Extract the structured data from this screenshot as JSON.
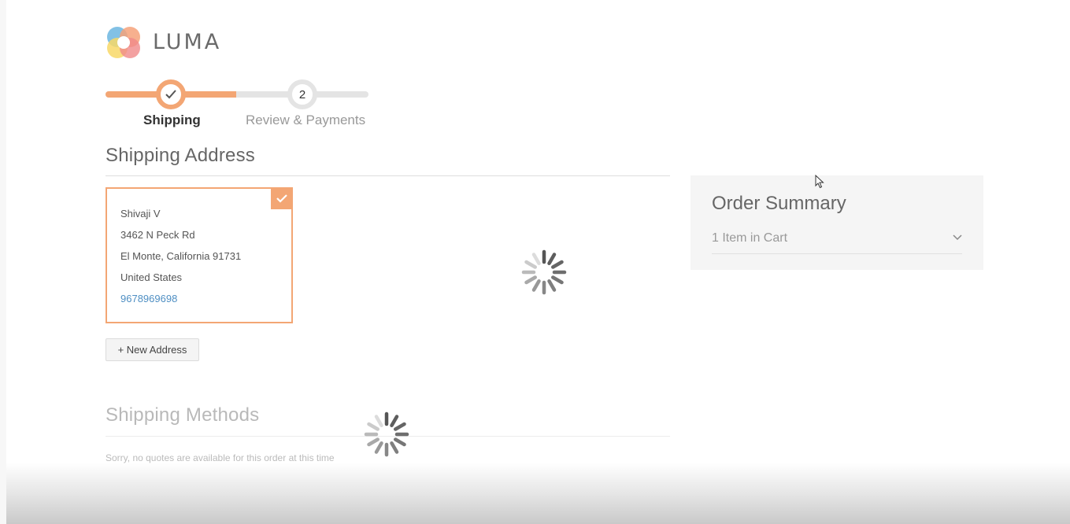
{
  "brand": {
    "name": "LUMA"
  },
  "progress": {
    "steps": [
      {
        "label": "Shipping",
        "state": "complete"
      },
      {
        "label": "Review & Payments",
        "number": "2",
        "state": "pending"
      }
    ]
  },
  "shipping_address": {
    "title": "Shipping Address",
    "selected_address": {
      "name": "Shivaji V",
      "street": "3462 N Peck Rd",
      "city_line": "El Monte, California 91731",
      "country": "United States",
      "phone": "9678969698"
    },
    "new_address_label": "+ New Address"
  },
  "shipping_methods": {
    "title": "Shipping Methods",
    "message": "Sorry, no quotes are available for this order at this time"
  },
  "order_summary": {
    "title": "Order Summary",
    "items_label": "1 Item in Cart"
  },
  "colors": {
    "accent": "#f3a674",
    "link": "#4f8fc3",
    "summary_bg": "#f5f5f5"
  },
  "icons": [
    "luma-logo-icon",
    "checkmark-icon",
    "chevron-down-icon",
    "loading-spinner-icon",
    "mouse-cursor-icon"
  ]
}
